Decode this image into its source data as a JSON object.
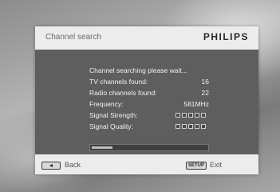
{
  "header": {
    "title": "Channel search",
    "brand": "PHILIPS"
  },
  "status": "Channel searching please wait...",
  "rows": [
    {
      "label": "TV channels found:",
      "value": "16"
    },
    {
      "label": "Radio channels found:",
      "value": "22"
    },
    {
      "label": "Frequency:",
      "value": "581MHz"
    },
    {
      "label": "Signal Strength:",
      "level": 0,
      "max": 5
    },
    {
      "label": "Signal Quality:",
      "level": 0,
      "max": 5
    }
  ],
  "progress": {
    "fraction": 0.18
  },
  "footer": {
    "back_label": "Back",
    "setup_key": "SETUP",
    "exit_label": "Exit"
  }
}
